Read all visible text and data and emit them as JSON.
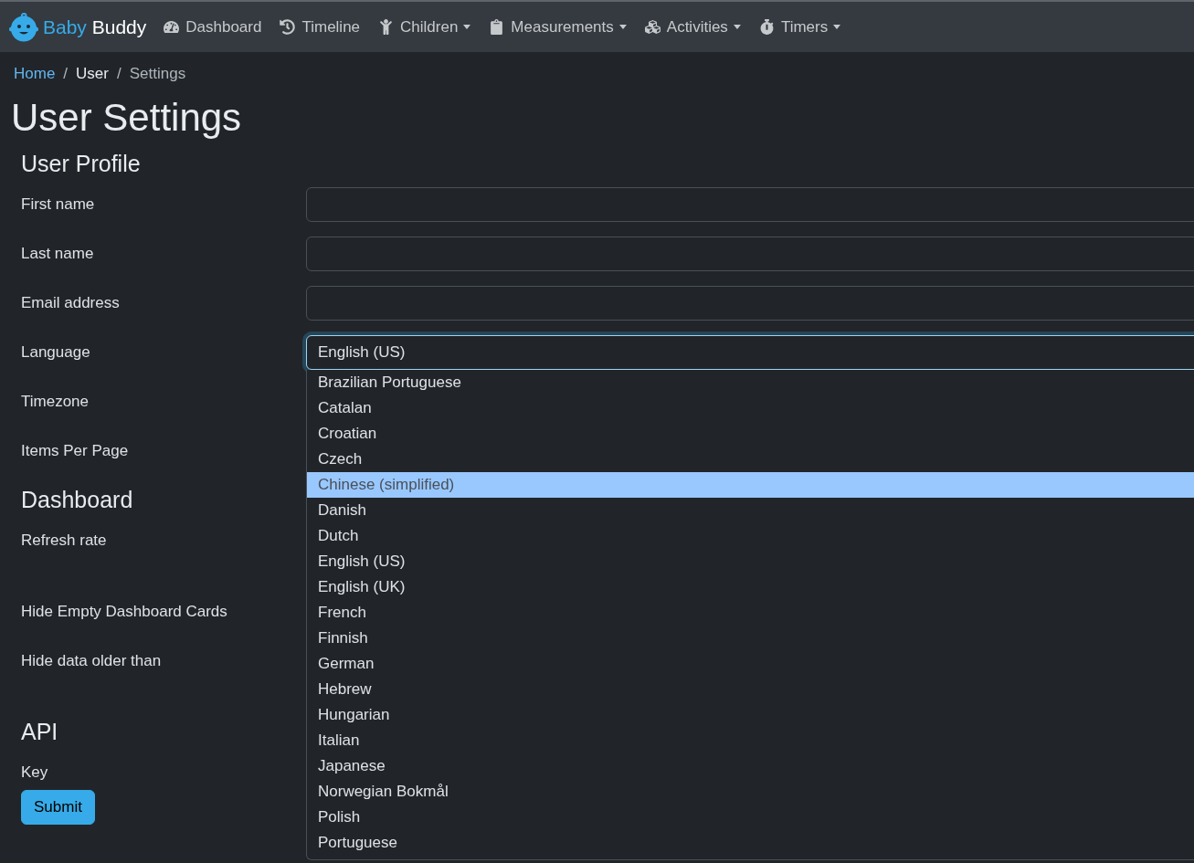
{
  "navbar": {
    "brand": {
      "first": "Baby",
      "second": "Buddy"
    },
    "items": [
      {
        "label": "Dashboard",
        "dropdown": false
      },
      {
        "label": "Timeline",
        "dropdown": false
      },
      {
        "label": "Children",
        "dropdown": true
      },
      {
        "label": "Measurements",
        "dropdown": true
      },
      {
        "label": "Activities",
        "dropdown": true
      },
      {
        "label": "Timers",
        "dropdown": true
      }
    ]
  },
  "breadcrumb": {
    "separator": "/",
    "items": [
      {
        "label": "Home",
        "kind": "link"
      },
      {
        "label": "User",
        "kind": "text"
      },
      {
        "label": "Settings",
        "kind": "current"
      }
    ]
  },
  "page_title": "User Settings",
  "sections": [
    {
      "title": "User Profile",
      "fields": [
        {
          "label": "First name",
          "kind": "input"
        },
        {
          "label": "Last name",
          "kind": "input"
        },
        {
          "label": "Email address",
          "kind": "input"
        },
        {
          "label": "Language",
          "kind": "select",
          "value": "English (US)",
          "focused": true,
          "expanded": true,
          "options": [
            {
              "label": "Brazilian Portuguese",
              "highlighted": false
            },
            {
              "label": "Catalan",
              "highlighted": false
            },
            {
              "label": "Croatian",
              "highlighted": false
            },
            {
              "label": "Czech",
              "highlighted": false
            },
            {
              "label": "Chinese (simplified)",
              "highlighted": true
            },
            {
              "label": "Danish",
              "highlighted": false
            },
            {
              "label": "Dutch",
              "highlighted": false
            },
            {
              "label": "English (US)",
              "highlighted": false
            },
            {
              "label": "English (UK)",
              "highlighted": false
            },
            {
              "label": "French",
              "highlighted": false
            },
            {
              "label": "Finnish",
              "highlighted": false
            },
            {
              "label": "German",
              "highlighted": false
            },
            {
              "label": "Hebrew",
              "highlighted": false
            },
            {
              "label": "Hungarian",
              "highlighted": false
            },
            {
              "label": "Italian",
              "highlighted": false
            },
            {
              "label": "Japanese",
              "highlighted": false
            },
            {
              "label": "Norwegian Bokmål",
              "highlighted": false
            },
            {
              "label": "Polish",
              "highlighted": false
            },
            {
              "label": "Portuguese",
              "highlighted": false
            }
          ]
        },
        {
          "label": "Timezone",
          "kind": "label_only"
        },
        {
          "label": "Items Per Page",
          "kind": "label_only"
        }
      ]
    },
    {
      "title": "Dashboard",
      "fields": [
        {
          "label": "Refresh rate",
          "kind": "label_only"
        },
        {
          "label": "Hide Empty Dashboard Cards",
          "kind": "label_only"
        },
        {
          "label": "Hide data older than",
          "kind": "label_only"
        }
      ]
    },
    {
      "title": "API",
      "fields": [
        {
          "label": "Key",
          "kind": "label_only"
        }
      ]
    }
  ],
  "submit_button": "Submit"
}
